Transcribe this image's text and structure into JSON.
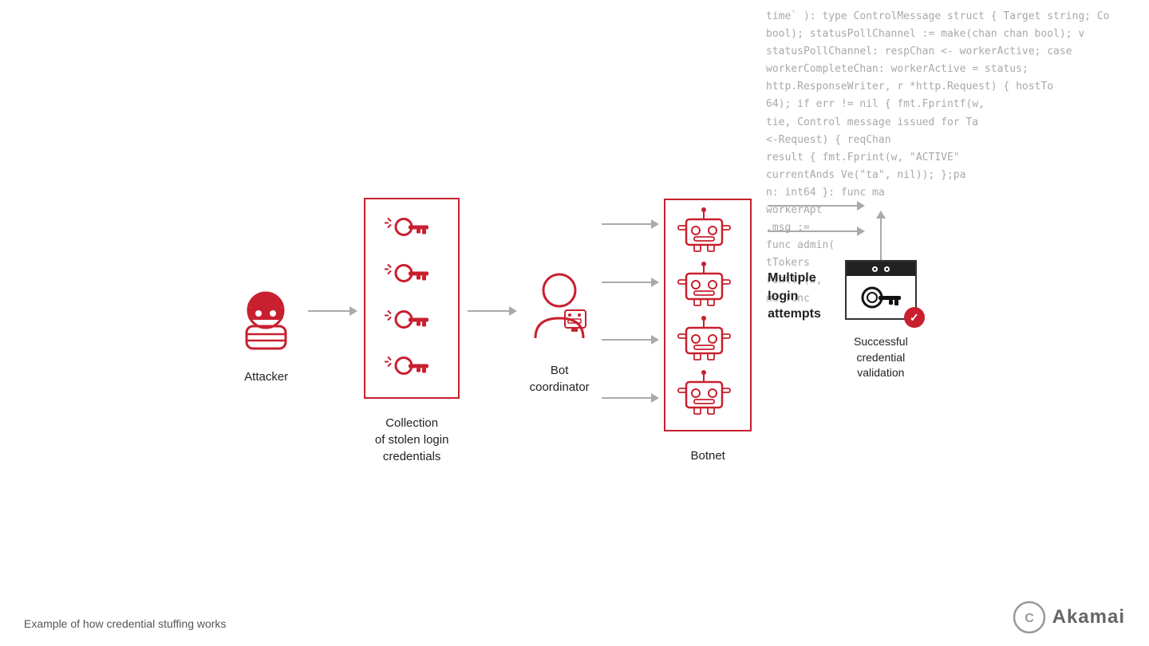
{
  "code_lines": [
    "time` ): type ControlMessage struct { Target string; Co",
    "       bool); statusPollChannel := make(chan chan bool); v",
    "       statusPollChannel: respChan <- workerActive; case",
    "       workerCompleteChan: workerActive = status;",
    "       http.ResponseWriter, r *http.Request) { hostTo",
    "    64); if err != nil { fmt.Fprintf(w,",
    "    tie,  Control message issued for Ta",
    "       <-Request) { reqChan",
    "   result { fmt.Fprint(w, \"ACTIVE\"",
    "   currentAnds Ve(\"ta\", nil)); };pa",
    "   n: int64 }: func ma",
    "       workerApt",
    "   .msg :=",
    "   func admin(",
    "       tTokers",
    "   rintlf(w,",
    "   nd func"
  ],
  "nodes": {
    "attacker": {
      "label": "Attacker"
    },
    "collection": {
      "label": "Collection\nof stolen login\ncredentials"
    },
    "coordinator": {
      "label": "Bot\ncoordinator"
    },
    "botnet": {
      "label": "Botnet"
    },
    "multiple_login": {
      "label": "Multiple\nlogin\nattempts"
    },
    "successful": {
      "label": "Successful\ncredential\nvalidation"
    }
  },
  "footer": {
    "caption": "Example of how credential stuffing works"
  },
  "brand": {
    "name": "Akamai"
  },
  "colors": {
    "red": "#c8202f",
    "gray_arrow": "#aaa",
    "dark": "#222",
    "text": "#333"
  }
}
